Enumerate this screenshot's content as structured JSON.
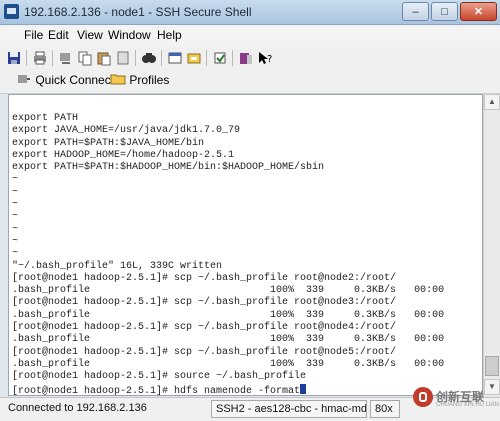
{
  "window": {
    "title": "192.168.2.136 - node1 - SSH Secure Shell",
    "buttons": [
      "minimize",
      "maximize",
      "close"
    ]
  },
  "menu": {
    "items": [
      "File",
      "Edit",
      "View",
      "Window",
      "Help"
    ]
  },
  "toolbar": {
    "icons": [
      "save-icon",
      "print-icon",
      "connect-icon",
      "copy-icon",
      "paste-icon",
      "find-icon",
      "new-window-icon",
      "settings-icon",
      "help-icon"
    ]
  },
  "toolbar2": {
    "quick_connect": "Quick Connect",
    "profiles": "Profiles"
  },
  "terminal": {
    "lines": [
      "export PATH",
      "export JAVA_HOME=/usr/java/jdk1.7.0_79",
      "export PATH=$PATH:$JAVA_HOME/bin",
      "export HADOOP_HOME=/home/hadoop-2.5.1",
      "export PATH=$PATH:$HADOOP_HOME/bin:$HADOOP_HOME/sbin",
      "~",
      "~",
      "~",
      "~",
      "~",
      "~",
      "~",
      "\"~/.bash_profile\" 16L, 339C written",
      "[root@node1 hadoop-2.5.1]# scp ~/.bash_profile root@node2:/root/",
      ".bash_profile                              100%  339     0.3KB/s   00:00",
      "[root@node1 hadoop-2.5.1]# scp ~/.bash_profile root@node3:/root/",
      ".bash_profile                              100%  339     0.3KB/s   00:00",
      "[root@node1 hadoop-2.5.1]# scp ~/.bash_profile root@node4:/root/",
      ".bash_profile                              100%  339     0.3KB/s   00:00",
      "[root@node1 hadoop-2.5.1]# scp ~/.bash_profile root@node5:/root/",
      ".bash_profile                              100%  339     0.3KB/s   00:00",
      "[root@node1 hadoop-2.5.1]# source ~/.bash_profile"
    ],
    "last_line": "[root@node1 hadoop-2.5.1]# hdfs namenode -format"
  },
  "status": {
    "connection": "Connected to 192.168.2.136",
    "cipher": "SSH2 - aes128-cbc - hmac-md5",
    "size": "80x"
  },
  "watermark": {
    "name": "创新互联",
    "sub": "CHUANG XIN HU LIAN"
  }
}
